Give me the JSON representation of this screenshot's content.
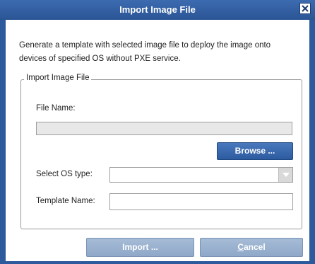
{
  "dialog": {
    "title": "Import Image File",
    "description": "Generate a template with selected image file to deploy the image onto devices of specified OS without PXE service."
  },
  "group": {
    "legend": "Import Image File",
    "file_name_label": "File Name:",
    "file_name_value": "",
    "browse_label": "Browse ...",
    "os_type_label": "Select OS type:",
    "os_type_value": "",
    "template_name_label": "Template Name:",
    "template_name_value": ""
  },
  "buttons": {
    "import_label": "Import ...",
    "cancel_first_letter": "C",
    "cancel_rest": "ancel"
  },
  "icons": {
    "close": "close-icon",
    "dropdown": "chevron-down-icon"
  },
  "colors": {
    "titlebar": "#2d5a9c",
    "primary_button": "#3567ad",
    "disabled_button": "#9bb2cf"
  }
}
